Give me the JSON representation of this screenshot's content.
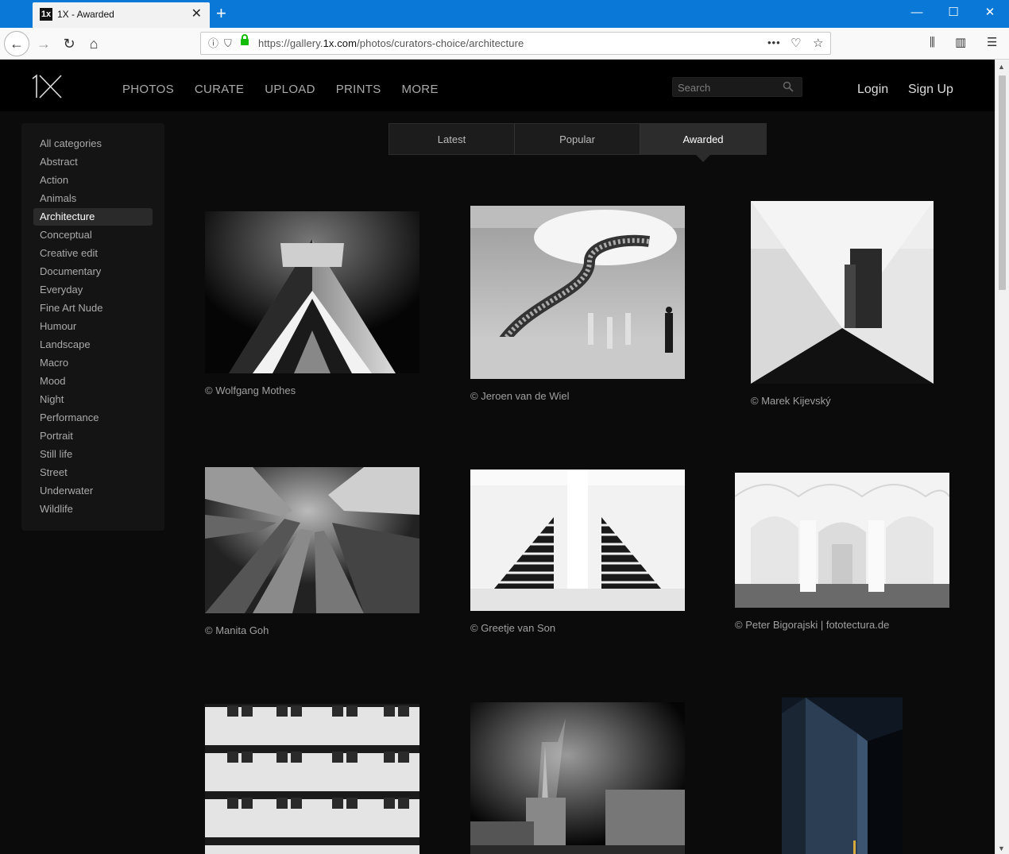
{
  "browser": {
    "tab_title": "1X - Awarded",
    "tab_favicon_text": "1x",
    "url_prefix": "https://gallery.",
    "url_host": "1x.com",
    "url_path": "/photos/curators-choice/architecture",
    "page_actions_label": "•••"
  },
  "site": {
    "nav": [
      "PHOTOS",
      "CURATE",
      "UPLOAD",
      "PRINTS",
      "MORE"
    ],
    "search_placeholder": "Search",
    "login": "Login",
    "signup": "Sign Up"
  },
  "categories": [
    "All categories",
    "Abstract",
    "Action",
    "Animals",
    "Architecture",
    "Conceptual",
    "Creative edit",
    "Documentary",
    "Everyday",
    "Fine Art Nude",
    "Humour",
    "Landscape",
    "Macro",
    "Mood",
    "Night",
    "Performance",
    "Portrait",
    "Still life",
    "Street",
    "Underwater",
    "Wildlife"
  ],
  "active_category": "Architecture",
  "tabs": [
    "Latest",
    "Popular",
    "Awarded"
  ],
  "active_tab": "Awarded",
  "photos": [
    {
      "credit": "© Wolfgang Mothes"
    },
    {
      "credit": "© Jeroen van de Wiel"
    },
    {
      "credit": "© Marek Kijevský"
    },
    {
      "credit": "© Manita Goh"
    },
    {
      "credit": "© Greetje van Son"
    },
    {
      "credit": "© Peter Bigorajski | fototectura.de"
    },
    {
      "credit": ""
    },
    {
      "credit": ""
    },
    {
      "credit": ""
    }
  ]
}
